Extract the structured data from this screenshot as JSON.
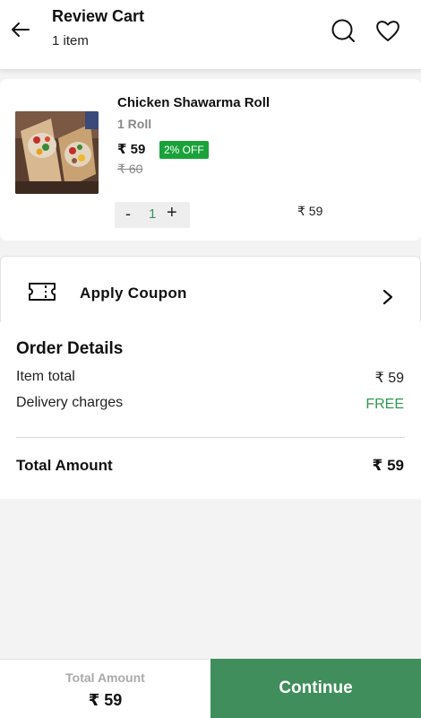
{
  "header": {
    "title": "Review Cart",
    "subtitle": "1 item"
  },
  "cart_item": {
    "name": "Chicken Shawarma Roll",
    "variant": "1 Roll",
    "price": "₹ 59",
    "discount_badge": "2% OFF",
    "mrp": "₹ 60",
    "quantity": "1",
    "minus_label": "-",
    "plus_label": "+",
    "line_total": "₹ 59"
  },
  "coupon": {
    "label": "Apply Coupon"
  },
  "order_details": {
    "heading": "Order Details",
    "rows": [
      {
        "label": "Item total",
        "value": "₹ 59"
      },
      {
        "label": "Delivery charges",
        "value": "FREE"
      }
    ],
    "total_label": "Total Amount",
    "total_value": "₹ 59"
  },
  "footer": {
    "total_label": "Total Amount",
    "total_value": "₹ 59",
    "continue_label": "Continue"
  },
  "colors": {
    "accent_green": "#3f8e5b",
    "badge_green": "#1aa23a",
    "free_green": "#2e9a4e"
  },
  "icons": [
    "arrow-left-icon",
    "search-icon",
    "heart-icon",
    "coupon-ticket-icon",
    "chevron-right-icon"
  ]
}
